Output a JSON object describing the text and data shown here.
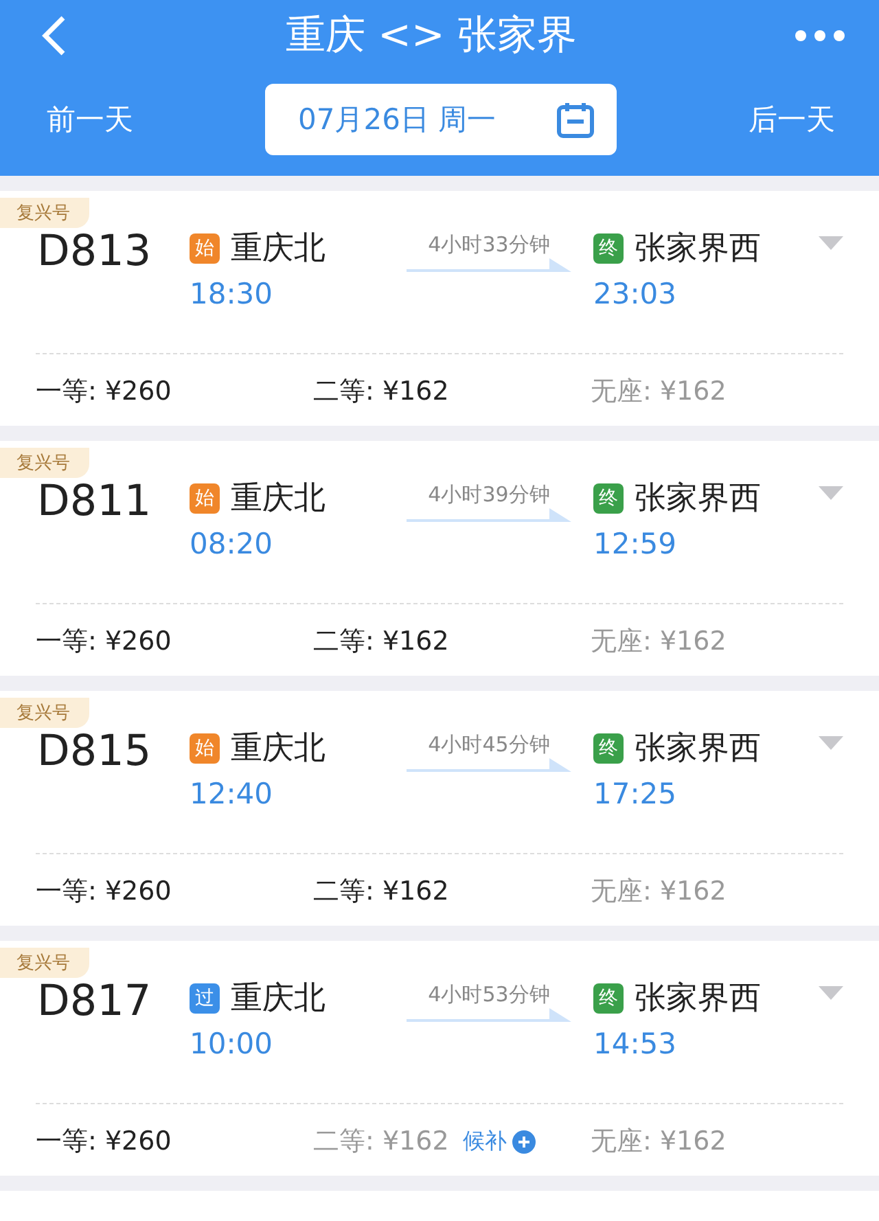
{
  "header": {
    "title": "重庆 <> 张家界",
    "prev_day": "前一天",
    "date": "07月26日 周一",
    "next_day": "后一天"
  },
  "trains": [
    {
      "tag": "复兴号",
      "number": "D813",
      "from": {
        "badge": "始",
        "color": "#f0862a",
        "station": "重庆北",
        "time": "18:30"
      },
      "duration": "4小时33分钟",
      "to": {
        "badge": "终",
        "color": "#3aa04a",
        "station": "张家界西",
        "time": "23:03"
      },
      "seats": [
        {
          "label": "一等: ¥260",
          "available": true
        },
        {
          "label": "二等: ¥162",
          "available": true
        },
        {
          "label": "无座: ¥162",
          "available": false
        }
      ]
    },
    {
      "tag": "复兴号",
      "number": "D811",
      "from": {
        "badge": "始",
        "color": "#f0862a",
        "station": "重庆北",
        "time": "08:20"
      },
      "duration": "4小时39分钟",
      "to": {
        "badge": "终",
        "color": "#3aa04a",
        "station": "张家界西",
        "time": "12:59"
      },
      "seats": [
        {
          "label": "一等: ¥260",
          "available": true
        },
        {
          "label": "二等: ¥162",
          "available": true
        },
        {
          "label": "无座: ¥162",
          "available": false
        }
      ]
    },
    {
      "tag": "复兴号",
      "number": "D815",
      "from": {
        "badge": "始",
        "color": "#f0862a",
        "station": "重庆北",
        "time": "12:40"
      },
      "duration": "4小时45分钟",
      "to": {
        "badge": "终",
        "color": "#3aa04a",
        "station": "张家界西",
        "time": "17:25"
      },
      "seats": [
        {
          "label": "一等: ¥260",
          "available": true
        },
        {
          "label": "二等: ¥162",
          "available": true
        },
        {
          "label": "无座: ¥162",
          "available": false
        }
      ]
    },
    {
      "tag": "复兴号",
      "number": "D817",
      "from": {
        "badge": "过",
        "color": "#3b8fe8",
        "station": "重庆北",
        "time": "10:00"
      },
      "duration": "4小时53分钟",
      "to": {
        "badge": "终",
        "color": "#3aa04a",
        "station": "张家界西",
        "time": "14:53"
      },
      "seats": [
        {
          "label": "一等: ¥260",
          "available": true
        },
        {
          "label": "二等: ¥162",
          "available": false,
          "waitlist": "候补"
        },
        {
          "label": "无座: ¥162",
          "available": false
        }
      ]
    }
  ]
}
